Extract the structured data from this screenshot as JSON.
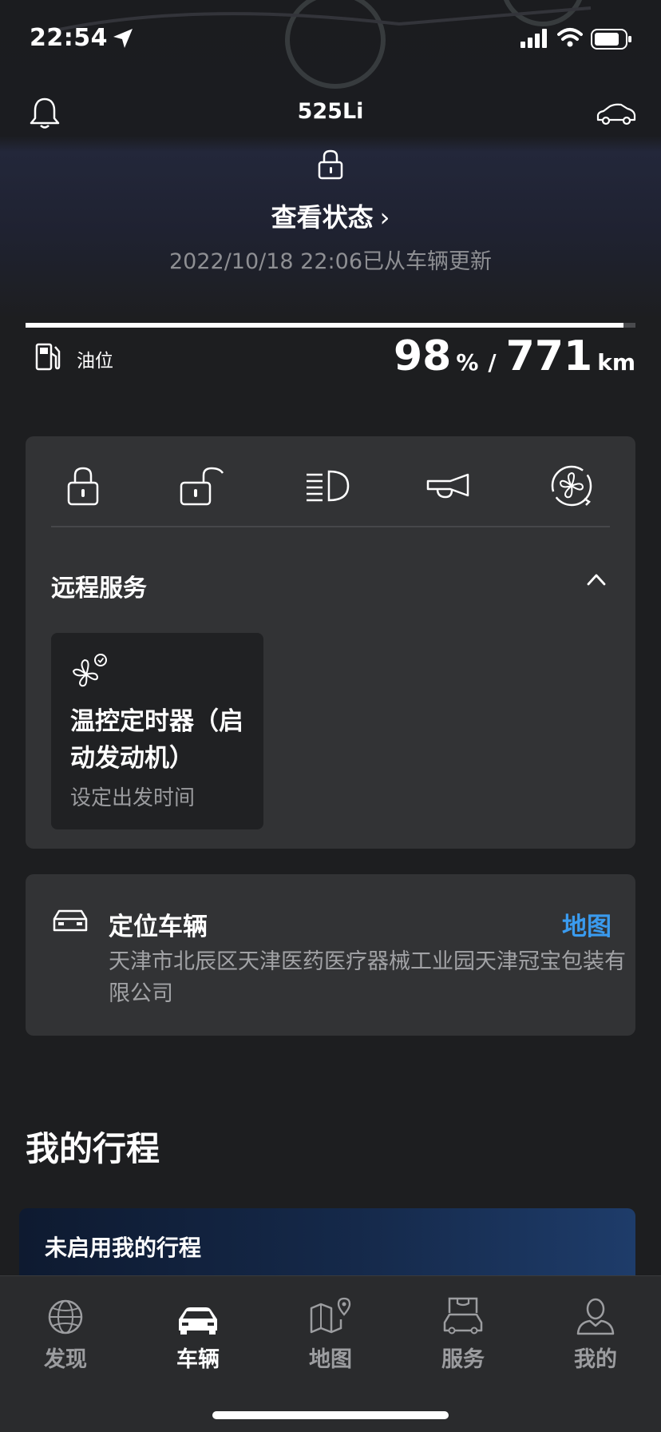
{
  "status_bar": {
    "time": "22:54"
  },
  "header": {
    "model": "525Li"
  },
  "vehicle_status": {
    "view_status_label": "查看状态",
    "chevron": "›",
    "updated_text": "2022/10/18 22:06已从车辆更新"
  },
  "fuel": {
    "label": "油位",
    "percent": "98",
    "percent_unit": "%",
    "separator": "/",
    "range": "771",
    "range_unit": "km",
    "level_fraction": 0.98
  },
  "remote_actions": [
    {
      "icon": "lock-icon"
    },
    {
      "icon": "unlock-icon"
    },
    {
      "icon": "headlight-icon"
    },
    {
      "icon": "horn-icon"
    },
    {
      "icon": "ventilation-icon"
    }
  ],
  "remote_services": {
    "title": "远程服务",
    "tile_title": "温控定时器（启动发动机）",
    "tile_subtitle": "设定出发时间"
  },
  "locate": {
    "title": "定位车辆",
    "map_link": "地图",
    "address": "天津市北辰区天津医药医疗器械工业园天津冠宝包装有限公司"
  },
  "trips": {
    "title": "我的行程",
    "card_text": "未启用我的行程"
  },
  "tabs": [
    {
      "label": "发现",
      "icon": "globe-icon",
      "active": false
    },
    {
      "label": "车辆",
      "icon": "car-icon",
      "active": true
    },
    {
      "label": "地图",
      "icon": "map-icon",
      "active": false
    },
    {
      "label": "服务",
      "icon": "service-icon",
      "active": false
    },
    {
      "label": "我的",
      "icon": "profile-icon",
      "active": false
    }
  ],
  "colors": {
    "accent_blue": "#3a9bef",
    "background": "#1d1e20",
    "card": "#323335"
  }
}
